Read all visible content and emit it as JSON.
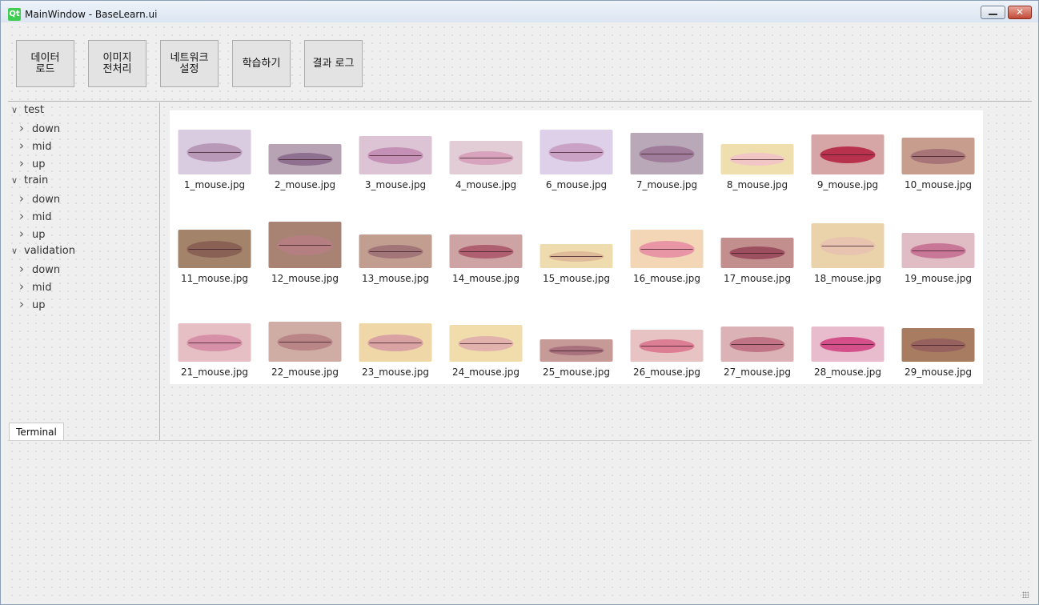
{
  "window": {
    "app_icon": "Qt",
    "title": "MainWindow - BaseLearn.ui",
    "minimize_icon": "minimize-icon",
    "close_icon": "close-icon",
    "close_glyph": "✕"
  },
  "toolbar": {
    "buttons": [
      {
        "label": "데이터\n로드"
      },
      {
        "label": "이미지\n전처리"
      },
      {
        "label": "네트워크\n설정"
      },
      {
        "label": "학습하기"
      },
      {
        "label": "결과 로그"
      }
    ]
  },
  "tree": {
    "expanded_icon": "chevron-down-icon",
    "collapsed_icon": "chevron-right-icon",
    "items": [
      {
        "label": "test",
        "level": 0,
        "expanded": true
      },
      {
        "label": "down",
        "level": 1,
        "expanded": false
      },
      {
        "label": "mid",
        "level": 1,
        "expanded": false
      },
      {
        "label": "up",
        "level": 1,
        "expanded": false
      },
      {
        "label": "train",
        "level": 0,
        "expanded": true
      },
      {
        "label": "down",
        "level": 1,
        "expanded": false
      },
      {
        "label": "mid",
        "level": 1,
        "expanded": false
      },
      {
        "label": "up",
        "level": 1,
        "expanded": false
      },
      {
        "label": "validation",
        "level": 0,
        "expanded": true
      },
      {
        "label": "down",
        "level": 1,
        "expanded": false
      },
      {
        "label": "mid",
        "level": 1,
        "expanded": false
      },
      {
        "label": "up",
        "level": 1,
        "expanded": false
      }
    ]
  },
  "gallery": {
    "thumbnails": [
      {
        "name": "1_mouse.jpg",
        "bg": "#d9cbe0",
        "lip": "#b89ab8"
      },
      {
        "name": "2_mouse.jpg",
        "bg": "#b7a3b3",
        "lip": "#8f7090"
      },
      {
        "name": "3_mouse.jpg",
        "bg": "#dcc4d4",
        "lip": "#c590b5"
      },
      {
        "name": "4_mouse.jpg",
        "bg": "#e2cdd6",
        "lip": "#d7a3bd"
      },
      {
        "name": "6_mouse.jpg",
        "bg": "#ddd0e8",
        "lip": "#c9a2c6"
      },
      {
        "name": "7_mouse.jpg",
        "bg": "#b9a8b8",
        "lip": "#9e7c9a"
      },
      {
        "name": "8_mouse.jpg",
        "bg": "#f0dfae",
        "lip": "#f1c6c4"
      },
      {
        "name": "9_mouse.jpg",
        "bg": "#d6a6a6",
        "lip": "#b8324e"
      },
      {
        "name": "10_mouse.jpg",
        "bg": "#c79e8e",
        "lip": "#a77478"
      },
      {
        "name": "11_mouse.jpg",
        "bg": "#a3836a",
        "lip": "#8a6155"
      },
      {
        "name": "12_mouse.jpg",
        "bg": "#a88374",
        "lip": "#b57f82"
      },
      {
        "name": "13_mouse.jpg",
        "bg": "#c19e90",
        "lip": "#a27679"
      },
      {
        "name": "14_mouse.jpg",
        "bg": "#cda3a3",
        "lip": "#ae5f70"
      },
      {
        "name": "15_mouse.jpg",
        "bg": "#efdcae",
        "lip": "#e0bb9a"
      },
      {
        "name": "16_mouse.jpg",
        "bg": "#f2d6b6",
        "lip": "#e895a5"
      },
      {
        "name": "17_mouse.jpg",
        "bg": "#c28e8e",
        "lip": "#9c4f5e"
      },
      {
        "name": "18_mouse.jpg",
        "bg": "#ead2aa",
        "lip": "#e8c4b0"
      },
      {
        "name": "19_mouse.jpg",
        "bg": "#e0bcc4",
        "lip": "#c97796"
      },
      {
        "name": "21_mouse.jpg",
        "bg": "#e6bfc4",
        "lip": "#d691a8"
      },
      {
        "name": "22_mouse.jpg",
        "bg": "#cfaca4",
        "lip": "#b98587"
      },
      {
        "name": "23_mouse.jpg",
        "bg": "#efd7a8",
        "lip": "#d9a2a3"
      },
      {
        "name": "24_mouse.jpg",
        "bg": "#f1dcac",
        "lip": "#e2b3ad"
      },
      {
        "name": "25_mouse.jpg",
        "bg": "#c59a97",
        "lip": "#a9707e"
      },
      {
        "name": "26_mouse.jpg",
        "bg": "#e8c3c3",
        "lip": "#dc7e94"
      },
      {
        "name": "27_mouse.jpg",
        "bg": "#dbb3b6",
        "lip": "#c07485"
      },
      {
        "name": "28_mouse.jpg",
        "bg": "#e8bccc",
        "lip": "#d4508a"
      },
      {
        "name": "29_mouse.jpg",
        "bg": "#a77c61",
        "lip": "#97615e"
      }
    ]
  },
  "terminal": {
    "tab_label": "Terminal",
    "content": ""
  }
}
